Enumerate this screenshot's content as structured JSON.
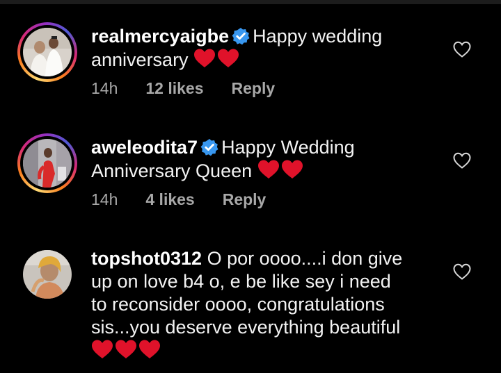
{
  "colors": {
    "background": "#000000",
    "text": "#f3f3f3",
    "meta": "#a8a8a8",
    "verified": "#3897f0",
    "heart": "#e0122a"
  },
  "comments": [
    {
      "username": "realmercyaigbe",
      "verified": true,
      "text_line1": "Happy wedding",
      "text_line2": "anniversary",
      "heart_count": 2,
      "time": "14h",
      "likes": "12 likes",
      "reply": "Reply",
      "has_story": true,
      "like_icon": "heart-outline-icon"
    },
    {
      "username": "aweleodita7",
      "verified": true,
      "text_line1": "Happy Wedding",
      "text_line2": "Anniversary Queen",
      "heart_count": 2,
      "time": "14h",
      "likes": "4 likes",
      "reply": "Reply",
      "has_story": true,
      "like_icon": "heart-outline-icon"
    },
    {
      "username": "topshot0312",
      "verified": false,
      "text_line1": "O por oooo....i don give",
      "text_line2": "up on love b4 o, e be like sey i need",
      "text_line3": "to reconsider oooo, congratulations",
      "text_line4": "sis...you deserve everything beautiful",
      "heart_count": 3,
      "has_story": false,
      "like_icon": "heart-outline-icon"
    }
  ]
}
